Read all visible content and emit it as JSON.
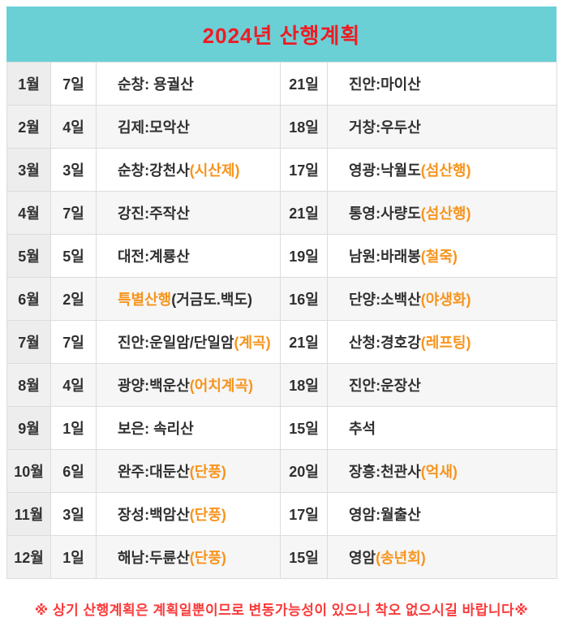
{
  "title": "2024년 산행계획",
  "footer_note": "※ 상기 산행계획은 계획일뿐이므로 변동가능성이 있으니 착오 없으시길 바랍니다※",
  "colors": {
    "teal": "#6bd0d6",
    "red": "#ed1c24",
    "footer_red": "#fa3a3a",
    "blue": "#1666d0",
    "orange": "#f7941d",
    "ink": "#303030",
    "border": "#dcdcdc",
    "stripe": "#f6f6f6",
    "month_bg": "#ededed",
    "month_bg_even": "#f0f0f0"
  },
  "rows": [
    {
      "month": "1월",
      "day1": "7일",
      "dest1": {
        "pre": "순창: 용궐산",
        "accent": "",
        "post": ""
      },
      "day2": "21일",
      "dest2": {
        "pre": "진안:마이산",
        "accent": "",
        "post": ""
      }
    },
    {
      "month": "2월",
      "day1": "4일",
      "dest1": {
        "pre": "김제:모악산",
        "accent": "",
        "post": ""
      },
      "day2": "18일",
      "dest2": {
        "pre": "거창:우두산",
        "accent": "",
        "post": ""
      }
    },
    {
      "month": "3월",
      "day1": "3일",
      "dest1": {
        "pre": "순창:강천사",
        "accent": "(시산제)",
        "post": ""
      },
      "day2": "17일",
      "dest2": {
        "pre": "영광:낙월도",
        "accent": "(섬산행)",
        "post": ""
      }
    },
    {
      "month": "4월",
      "day1": "7일",
      "dest1": {
        "pre": "강진:주작산",
        "accent": "",
        "post": ""
      },
      "day2": "21일",
      "dest2": {
        "pre": "통영:사량도",
        "accent": "(섬산행)",
        "post": ""
      }
    },
    {
      "month": "5월",
      "day1": "5일",
      "dest1": {
        "pre": "대전:계룡산",
        "accent": "",
        "post": ""
      },
      "day2": "19일",
      "dest2": {
        "pre": "남원:바래봉",
        "accent": "(철죽)",
        "post": ""
      }
    },
    {
      "month": "6월",
      "day1": "2일",
      "dest1": {
        "pre": "",
        "accent": "특별산행",
        "post": "(거금도.백도)"
      },
      "day2": "16일",
      "dest2": {
        "pre": "단양:소백산",
        "accent": "(야생화)",
        "post": ""
      }
    },
    {
      "month": "7월",
      "day1": "7일",
      "dest1": {
        "pre": "진안:운일암/단일암",
        "accent": "(계곡)",
        "post": ""
      },
      "day2": "21일",
      "dest2": {
        "pre": "산청:경호강",
        "accent": "(레프팅)",
        "post": ""
      }
    },
    {
      "month": "8월",
      "day1": "4일",
      "dest1": {
        "pre": "광양:백운산",
        "accent": "(어치계곡)",
        "post": ""
      },
      "day2": "18일",
      "dest2": {
        "pre": "진안:운장산",
        "accent": "",
        "post": ""
      }
    },
    {
      "month": "9월",
      "day1": "1일",
      "dest1": {
        "pre": "보은: 속리산",
        "accent": "",
        "post": ""
      },
      "day2": "15일",
      "dest2": {
        "pre": "추석",
        "accent": "",
        "post": ""
      }
    },
    {
      "month": "10월",
      "day1": "6일",
      "dest1": {
        "pre": "완주:대둔산",
        "accent": "(단풍)",
        "post": ""
      },
      "day2": "20일",
      "dest2": {
        "pre": "장흥:천관사",
        "accent": "(억새)",
        "post": ""
      }
    },
    {
      "month": "11월",
      "day1": "3일",
      "dest1": {
        "pre": "장성:백암산",
        "accent": "(단풍)",
        "post": ""
      },
      "day2": "17일",
      "dest2": {
        "pre": "영암:월출산",
        "accent": "",
        "post": ""
      }
    },
    {
      "month": "12월",
      "day1": "1일",
      "dest1": {
        "pre": "해남:두륜산",
        "accent": "(단풍)",
        "post": ""
      },
      "day2": "15일",
      "dest2": {
        "pre": "영암",
        "accent": "(송년회)",
        "post": ""
      }
    }
  ]
}
